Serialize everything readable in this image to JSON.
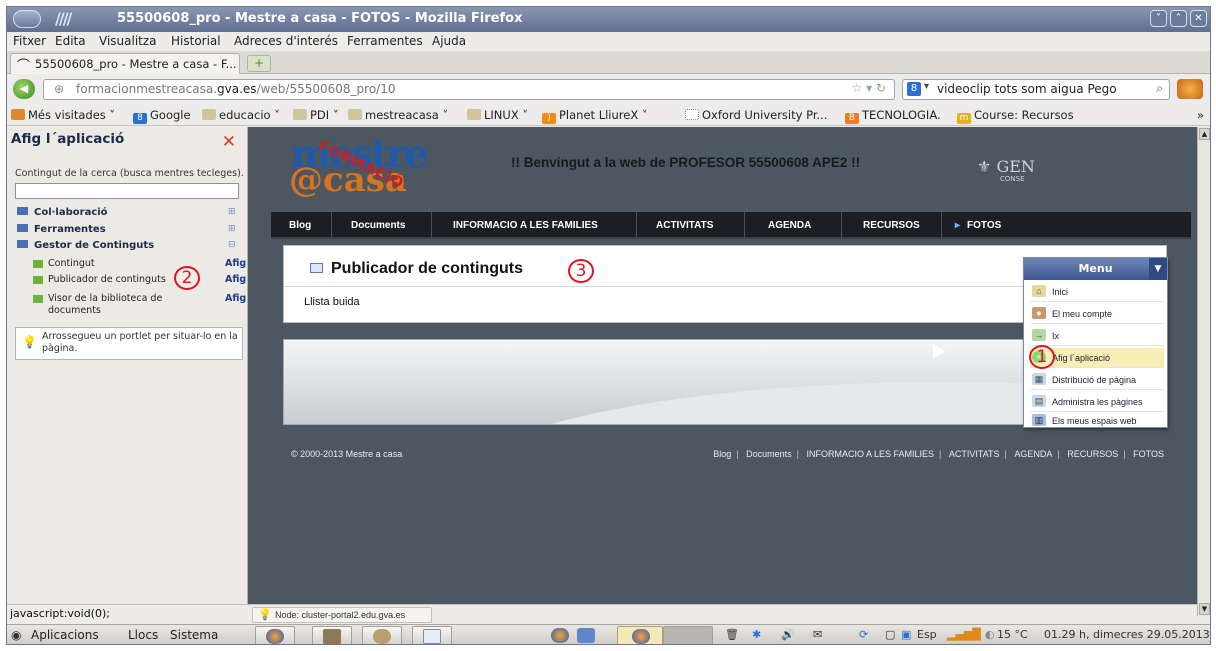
{
  "window": {
    "title": "55500608_pro - Mestre a casa - FOTOS - Mozilla Firefox",
    "controls": [
      "˅",
      "˄",
      "✕"
    ]
  },
  "menubar": [
    "Fitxer",
    "Edita",
    "Visualitza",
    "Historial",
    "Adreces d'interés",
    "Ferramentes",
    "Ajuda"
  ],
  "tab": {
    "label": "55500608_pro - Mestre a casa - F...",
    "new": "+"
  },
  "nav": {
    "url_prefix": "formacionmestreacasa.",
    "url_domain": "gva.es",
    "url_suffix": "/web/55500608_pro/10",
    "search_value": "videoclip tots som aigua Pego",
    "search_engine_icon": "8"
  },
  "bookmarks": [
    "Més visitades",
    "Google",
    "educacio",
    "PDI",
    "mestreacasa",
    "LINUX",
    "Planet LliureX",
    "Oxford University Pr...",
    "TECNOLOGIA.",
    "Course: Recursos"
  ],
  "bookmarks_more": "»",
  "panel": {
    "title": "Afig l´aplicació",
    "close": "✕",
    "search_hint": "Contingut de la cerca (busca mentres tecleges).",
    "search_value": "",
    "categories": [
      {
        "label": "Col·laboració",
        "toggle": "⊞"
      },
      {
        "label": "Ferramentes",
        "toggle": "⊞"
      },
      {
        "label": "Gestor de Continguts",
        "toggle": "⊟"
      }
    ],
    "items": [
      {
        "label": "Contingut",
        "action": "Afig"
      },
      {
        "label": "Publicador de continguts",
        "action": "Afig"
      },
      {
        "label": "Visor de la biblioteca de documents",
        "action": "Afig"
      }
    ],
    "tip": "Arrossegueu un portlet per situar-lo en la pàgina."
  },
  "site": {
    "logo_top": "mestre",
    "logo_bottom": "@casa",
    "logo_stamp": "FORMACIÓ",
    "welcome": "!! Benvingut a la web de PROFESOR 55500608 APE2 !!",
    "gen": "GEN",
    "gen_sub": "CONSE",
    "nav": [
      "Blog",
      "Documents",
      "INFORMACIO A LES FAMILIES",
      "ACTIVITATS",
      "AGENDA",
      "RECURSOS",
      "FOTOS"
    ],
    "portlet_title": "Publicador de continguts",
    "portlet_empty": "Llista buida",
    "copyright": "© 2000-2013 Mestre a casa",
    "footer_links": [
      "Blog",
      "Documents",
      "INFORMACIO A LES FAMILIES",
      "ACTIVITATS",
      "AGENDA",
      "RECURSOS",
      "FOTOS"
    ]
  },
  "menu": {
    "title": "Menu",
    "items": [
      "Inici",
      "El meu compte",
      "Ix",
      "Afig l´aplicació",
      "Distribució de pàgina",
      "Administra les pàgines",
      "Els meus espais web"
    ]
  },
  "annotations": [
    "1",
    "2",
    "3"
  ],
  "status": {
    "left": "javascript:void(0);",
    "node": "Node: cluster-portal2.edu.gva.es"
  },
  "taskbar": {
    "apps": [
      "Aplicacions",
      "Llocs",
      "Sistema"
    ],
    "lang": "Esp",
    "weather": "15 °C",
    "datetime": "01.29 h, dimecres 29.05.2013"
  },
  "colors": {
    "title_bar": "#6b7b9b",
    "site_bg": "#4d5761",
    "nav_bg": "#1b1f23",
    "annotation": "#e3121f",
    "menu_header": "#3c5791",
    "highlight": "#f6eeb5"
  }
}
